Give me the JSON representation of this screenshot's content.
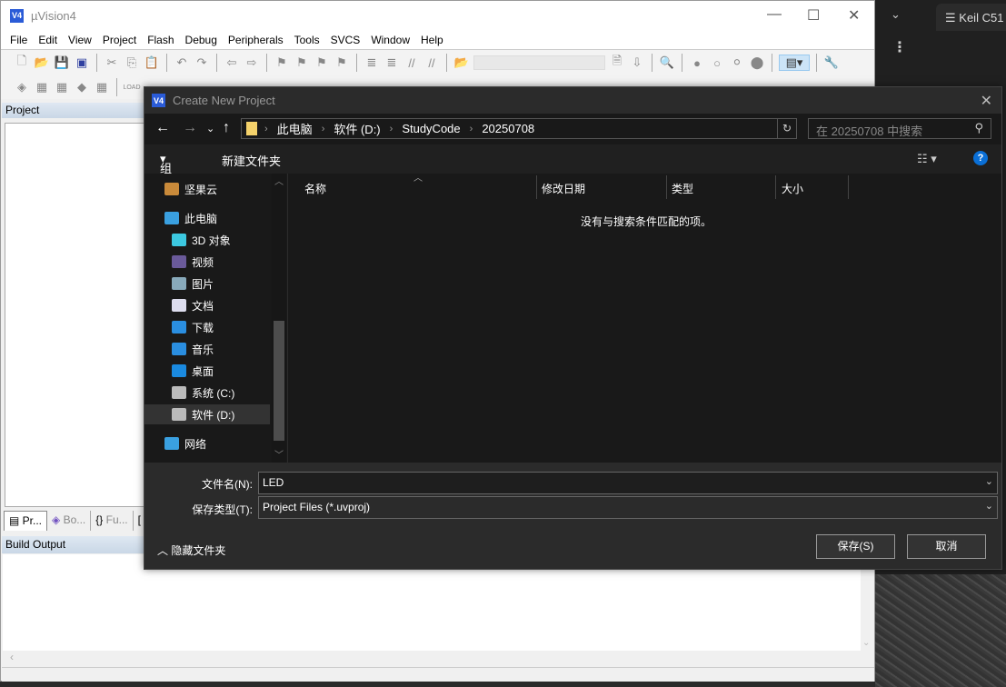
{
  "desktop": {
    "tab_label": "Keil C51",
    "tab_icon": "list-icon"
  },
  "app": {
    "title": "µVision4",
    "logo": "V4",
    "menu": [
      "File",
      "Edit",
      "View",
      "Project",
      "Flash",
      "Debug",
      "Peripherals",
      "Tools",
      "SVCS",
      "Window",
      "Help"
    ],
    "project_panel_title": "Project",
    "panel_tabs": [
      "Pr...",
      "Bo...",
      "Fu...",
      ""
    ],
    "build_output_title": "Build Output"
  },
  "dialog": {
    "title": "Create New Project",
    "breadcrumb": [
      "此电脑",
      "软件 (D:)",
      "StudyCode",
      "20250708"
    ],
    "search_placeholder": "在 20250708 中搜索",
    "organize": "组织",
    "new_folder": "新建文件夹",
    "sidebar": [
      {
        "label": "坚果云",
        "icon": "nutstore-icon",
        "color": "#c98a3a"
      },
      {
        "label": "此电脑",
        "icon": "computer-icon",
        "color": "#3aa0e0"
      },
      {
        "label": "3D 对象",
        "icon": "cube-icon",
        "color": "#3cc8e0"
      },
      {
        "label": "视频",
        "icon": "video-icon",
        "color": "#6a5a9a"
      },
      {
        "label": "图片",
        "icon": "picture-icon",
        "color": "#8ab"
      },
      {
        "label": "文档",
        "icon": "document-icon",
        "color": "#dde"
      },
      {
        "label": "下载",
        "icon": "download-icon",
        "color": "#2a8ee0"
      },
      {
        "label": "音乐",
        "icon": "music-icon",
        "color": "#2a8ee0"
      },
      {
        "label": "桌面",
        "icon": "desktop-icon",
        "color": "#1a8ae0"
      },
      {
        "label": "系统 (C:)",
        "icon": "drive-c-icon",
        "color": "#bbb"
      },
      {
        "label": "软件 (D:)",
        "icon": "drive-d-icon",
        "color": "#bbb"
      },
      {
        "label": "网络",
        "icon": "network-icon",
        "color": "#3aa0e0"
      }
    ],
    "selected_sidebar": "软件 (D:)",
    "columns": [
      "名称",
      "修改日期",
      "类型",
      "大小"
    ],
    "empty_message": "没有与搜索条件匹配的项。",
    "filename_label": "文件名(N):",
    "filename_value": "LED",
    "filetype_label": "保存类型(T):",
    "filetype_value": "Project Files (*.uvproj)",
    "hide_folders": "隐藏文件夹",
    "save": "保存(S)",
    "cancel": "取消"
  }
}
